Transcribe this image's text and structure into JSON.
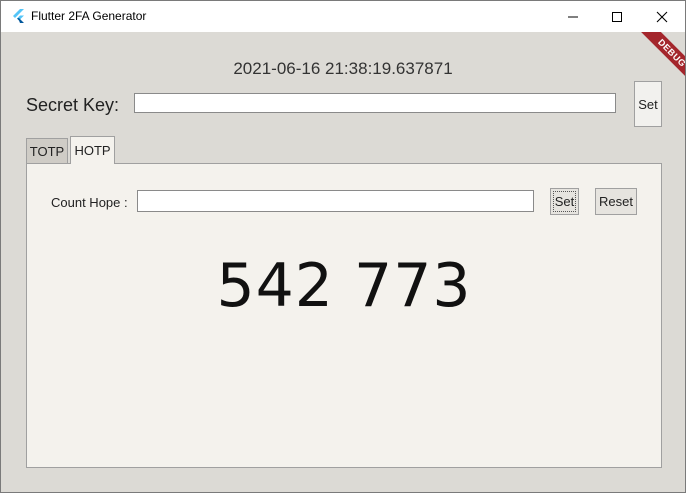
{
  "window": {
    "title": "Flutter 2FA Generator",
    "icon": "flutter-logo-icon",
    "controls": [
      "minimize-icon",
      "maximize-icon",
      "close-icon"
    ]
  },
  "debug_banner": "DEBUG",
  "datetime": "2021-06-16 21:38:19.637871",
  "secret": {
    "label": "Secret Key:",
    "value": "",
    "set_label": "Set"
  },
  "tabs": [
    {
      "label": "TOTP",
      "selected": false
    },
    {
      "label": "HOTP",
      "selected": true
    }
  ],
  "hotp": {
    "count_label": "Count Hope :",
    "count_value": "",
    "set_label": "Set",
    "reset_label": "Reset",
    "code": "542 773"
  },
  "colors": {
    "window_bg": "#dcdad5",
    "panel_bg": "#f4f2ed",
    "debug_banner": "#a4262c",
    "flutter_light": "#54c5f8",
    "flutter_dark": "#01579b"
  }
}
